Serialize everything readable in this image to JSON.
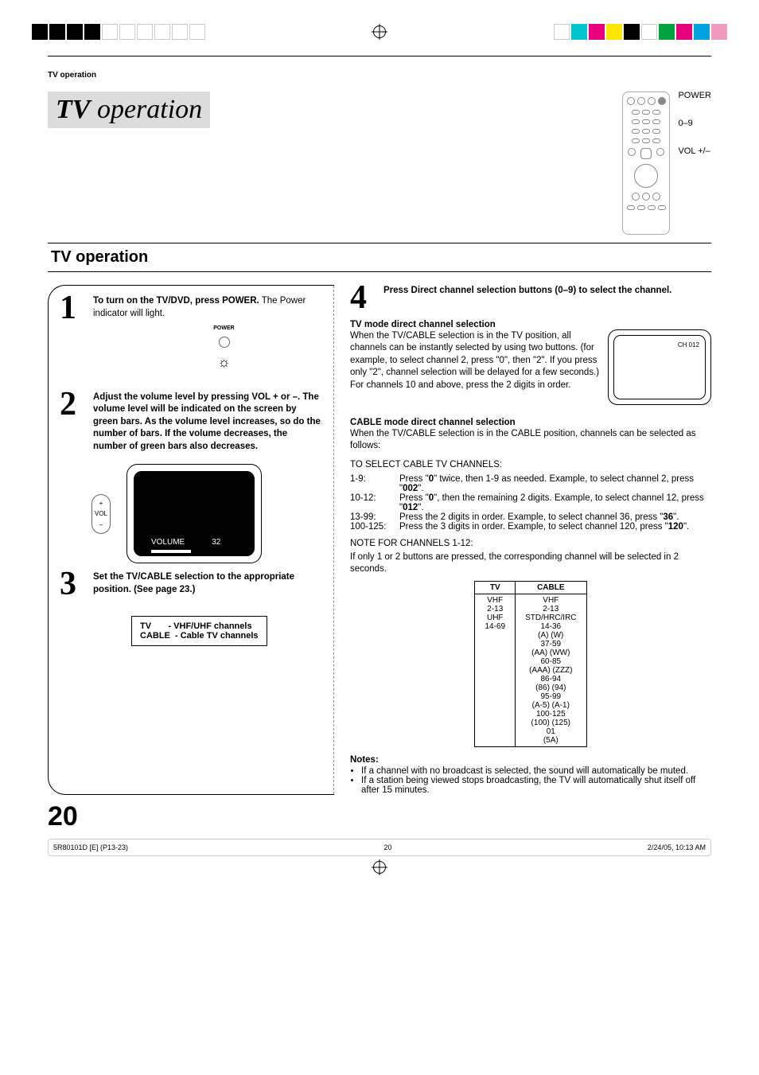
{
  "header": {
    "section_tag": "TV operation",
    "title_prefix": "TV",
    "title_rest": " operation",
    "remote_labels": [
      "POWER",
      "0–9",
      "VOL +/–"
    ]
  },
  "section_heading": "TV operation",
  "steps": {
    "s1": {
      "num": "1",
      "bold": "To turn on the TV/DVD, press POWER.",
      "text": " The Power indicator will light.",
      "led_label": "POWER"
    },
    "s2": {
      "num": "2",
      "bold": "Adjust the volume level by pressing VOL + or –. The volume level will be indicated on the screen by green bars. As the volume level increases, so do the number of bars. If the volume decreases, the number of green bars also decreases.",
      "vol_btn_label": "VOL",
      "screen_label": "VOLUME",
      "screen_value": "32"
    },
    "s3": {
      "num": "3",
      "bold": "Set the TV/CABLE selection to the appropriate position. (See page 23.)",
      "info_rows": [
        "TV       - VHF/UHF channels",
        "CABLE  - Cable TV channels"
      ]
    },
    "s4": {
      "num": "4",
      "bold": "Press Direct channel selection buttons (0–9) to select the channel."
    }
  },
  "right": {
    "tvmode_h": "TV mode direct channel selection",
    "tvmode_p1": "When the TV/CABLE selection is in the TV position, all channels can be instantly selected by using two buttons. (for example, to select channel 2, press \"0\", then \"2\". If you press only \"2\", channel selection will be delayed for a few seconds.) For channels 10 and above, press the 2 digits in order.",
    "osd_ch": "CH 012",
    "cablemode_h": "CABLE mode direct channel selection",
    "cablemode_p": "When the TV/CABLE selection is in the CABLE position, channels can be selected as follows:",
    "select_h": "TO SELECT CABLE TV CHANNELS:",
    "rows": [
      {
        "k": "1-9:",
        "v_pre": "Press \"",
        "v_b1": "0",
        "v_mid": "\" twice, then 1-9 as needed. Example, to select channel 2, press \"",
        "v_b2": "002",
        "v_post": "\"."
      },
      {
        "k": "10-12:",
        "v_pre": "Press \"",
        "v_b1": "0",
        "v_mid": "\", then the remaining 2 digits. Example, to select channel 12, press \"",
        "v_b2": "012",
        "v_post": "\"."
      },
      {
        "k": "13-99:",
        "v_pre": "Press the 2 digits in order. Example, to select channel 36, press \"",
        "v_b1": "36",
        "v_mid": "",
        "v_b2": "",
        "v_post": "\"."
      },
      {
        "k": "100-125:",
        "v_pre": "Press the 3 digits in order. Example, to select channel 120, press \"",
        "v_b1": "120",
        "v_mid": "",
        "v_b2": "",
        "v_post": "\"."
      }
    ],
    "note_h": "NOTE FOR CHANNELS 1-12:",
    "note_p": "If only 1 or 2 buttons are pressed, the corresponding channel will be selected in 2 seconds.",
    "table": {
      "head": [
        "TV",
        "CABLE"
      ],
      "tv_cells": [
        "VHF",
        "2-13",
        "UHF",
        "14-69"
      ],
      "cable_cells": [
        "VHF",
        "2-13",
        "STD/HRC/IRC",
        "14-36",
        "(A) (W)",
        "37-59",
        "(AA) (WW)",
        "60-85",
        "(AAA) (ZZZ)",
        "86-94",
        "(86) (94)",
        "95-99",
        "(A-5) (A-1)",
        "100-125",
        "(100) (125)",
        "01",
        "(5A)"
      ]
    }
  },
  "notes": {
    "h": "Notes:",
    "items": [
      "If a channel with no broadcast is selected, the sound will automatically be muted.",
      "If a station being viewed stops broadcasting, the TV will automatically shut itself off after 15 minutes."
    ]
  },
  "page_number": "20",
  "footer": {
    "left": "5R80101D [E] (P13-23)",
    "mid": "20",
    "right": "2/24/05, 10:13 AM"
  },
  "colorbar": [
    "#00c4cc",
    "#e6007e",
    "#ffe600",
    "#000000",
    "#00a33d",
    "#e6007e",
    "#00a3e0",
    "#f39ac0"
  ]
}
